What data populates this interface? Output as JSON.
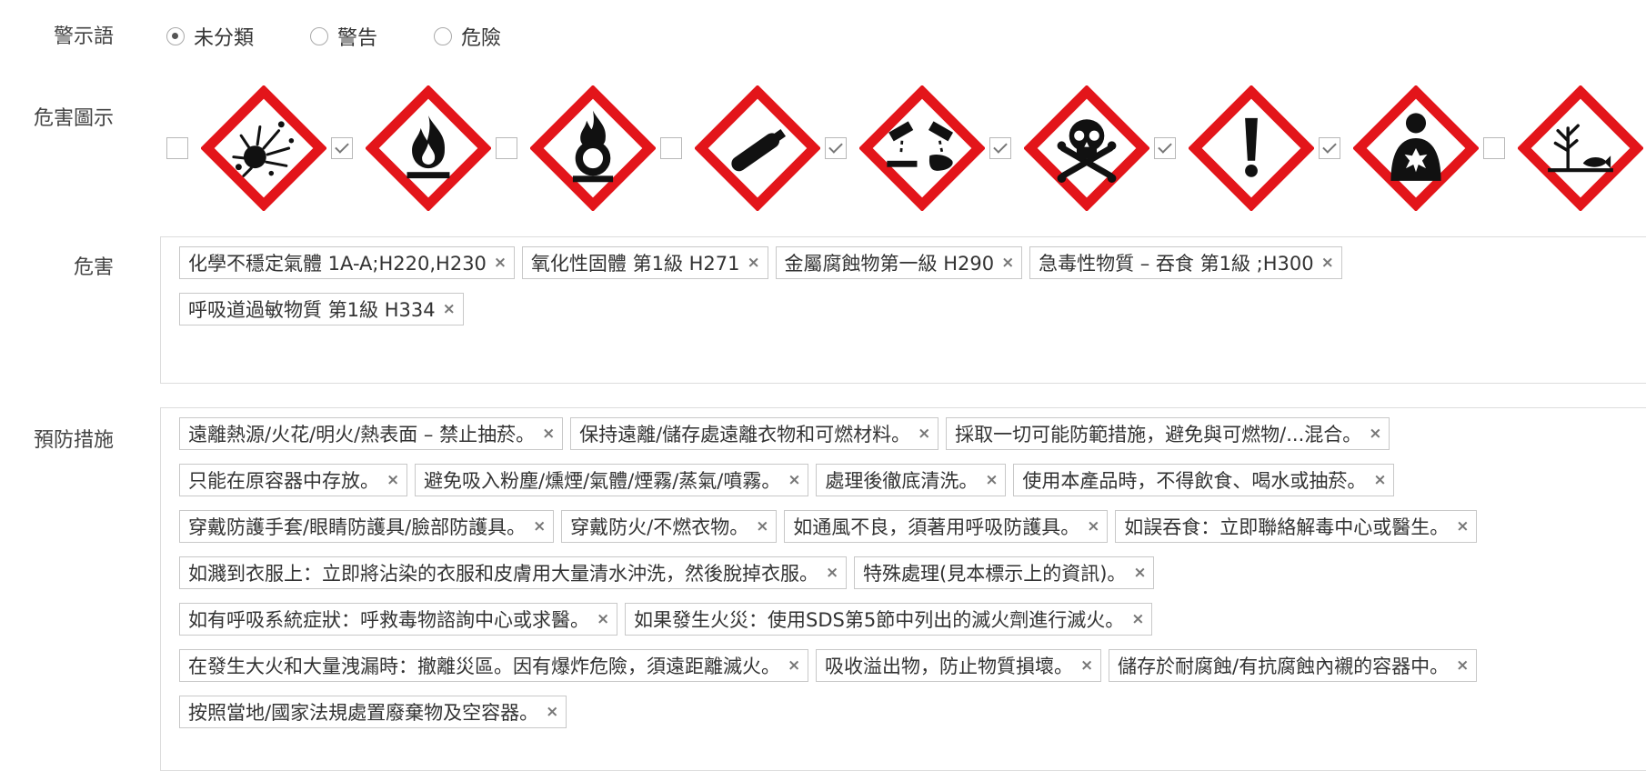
{
  "signal_word": {
    "label": "警示語",
    "options": [
      {
        "label": "未分類",
        "checked": true
      },
      {
        "label": "警告",
        "checked": false
      },
      {
        "label": "危險",
        "checked": false
      }
    ]
  },
  "pictograms": {
    "label": "危害圖示",
    "items": [
      {
        "icon": "explosive-bomb-icon",
        "checked": false
      },
      {
        "icon": "flame-icon",
        "checked": true
      },
      {
        "icon": "flame-over-circle-icon",
        "checked": false
      },
      {
        "icon": "gas-cylinder-icon",
        "checked": false
      },
      {
        "icon": "corrosion-icon",
        "checked": true
      },
      {
        "icon": "skull-crossbones-icon",
        "checked": true
      },
      {
        "icon": "exclamation-mark-icon",
        "checked": true
      },
      {
        "icon": "health-hazard-icon",
        "checked": true
      },
      {
        "icon": "environment-icon",
        "checked": false
      }
    ]
  },
  "hazards": {
    "label": "危害",
    "rows": [
      [
        "化學不穩定氣體 1A-A;H220,H230",
        "氧化性固體 第1級 H271",
        "金屬腐蝕物第一級 H290",
        "急毒性物質 – 吞食 第1級 ;H300"
      ],
      [
        "呼吸道過敏物質 第1級 H334"
      ]
    ]
  },
  "precautions": {
    "label": "預防措施",
    "rows": [
      [
        "遠離熱源/火花/明火/熱表面 – 禁止抽菸。",
        "保持遠離/儲存處遠離衣物和可燃材料。",
        "採取一切可能防範措施，避免與可燃物/...混合。"
      ],
      [
        "只能在原容器中存放。",
        "避免吸入粉塵/燻煙/氣體/煙霧/蒸氣/噴霧。",
        "處理後徹底清洗。",
        "使用本產品時，不得飲食、喝水或抽菸。"
      ],
      [
        "穿戴防護手套/眼睛防護具/臉部防護具。",
        "穿戴防火/不燃衣物。",
        "如通風不良，須著用呼吸防護具。",
        "如誤吞食：立即聯絡解毒中心或醫生。"
      ],
      [
        "如濺到衣服上：立即將沾染的衣服和皮膚用大量清水沖洗，然後脫掉衣服。",
        "特殊處理(見本標示上的資訊)。"
      ],
      [
        "如有呼吸系統症狀：呼救毒物諮詢中心或求醫。",
        "如果發生火災：使用SDS第5節中列出的滅火劑進行滅火。"
      ],
      [
        "在發生大火和大量洩漏時：撤離災區。因有爆炸危險，須遠距離滅火。",
        "吸收溢出物，防止物質損壞。",
        "儲存於耐腐蝕/有抗腐蝕內襯的容器中。"
      ],
      [
        "按照當地/國家法規處置廢棄物及空容器。"
      ]
    ]
  },
  "remove_glyph": "×",
  "colors": {
    "pictogram_border": "#e3151a",
    "pictogram_symbol": "#111111"
  }
}
